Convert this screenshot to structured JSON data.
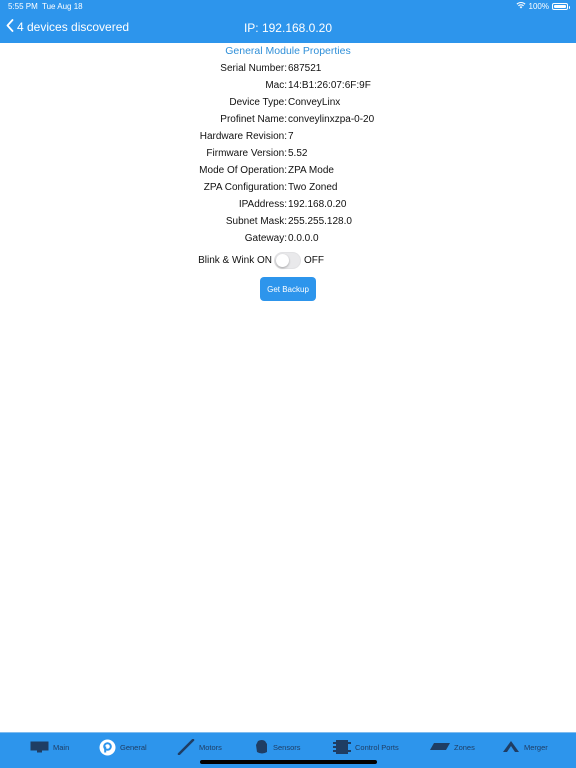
{
  "status_bar": {
    "time": "5:55 PM",
    "date": "Tue Aug 18",
    "battery": "100%"
  },
  "nav": {
    "back_label": "4 devices discovered",
    "title": "IP: 192.168.0.20"
  },
  "section_title": "General Module Properties",
  "properties": [
    {
      "label": "Serial Number:",
      "value": "687521"
    },
    {
      "label": "Mac:",
      "value": "14:B1:26:07:6F:9F"
    },
    {
      "label": "Device Type:",
      "value": "ConveyLinx"
    },
    {
      "label": "Profinet Name:",
      "value": "conveylinxzpa-0-20"
    },
    {
      "label": "Hardware Revision:",
      "value": "7"
    },
    {
      "label": "Firmware Version:",
      "value": "5.52"
    },
    {
      "label": "Mode Of Operation:",
      "value": "ZPA Mode"
    },
    {
      "label": "ZPA Configuration:",
      "value": "Two Zoned"
    },
    {
      "label": "IPAddress:",
      "value": "192.168.0.20"
    },
    {
      "label": "Subnet Mask:",
      "value": "255.255.128.0"
    },
    {
      "label": "Gateway:",
      "value": "0.0.0.0"
    }
  ],
  "blink_wink": {
    "label": "Blink & Wink ON",
    "off_label": "OFF",
    "enabled": false
  },
  "backup_button": "Get Backup",
  "tabs": [
    {
      "label": "Main",
      "icon": "monitor-icon"
    },
    {
      "label": "General",
      "icon": "general-icon"
    },
    {
      "label": "Motors",
      "icon": "motor-roller-icon"
    },
    {
      "label": "Sensors",
      "icon": "sensor-icon"
    },
    {
      "label": "Control Ports",
      "icon": "control-ports-icon"
    },
    {
      "label": "Zones",
      "icon": "zones-icon"
    },
    {
      "label": "Merger",
      "icon": "merger-icon"
    }
  ],
  "colors": {
    "accent": "#2d95ec",
    "section_title": "#2f8fd8",
    "tab_text": "#1f3d63"
  }
}
